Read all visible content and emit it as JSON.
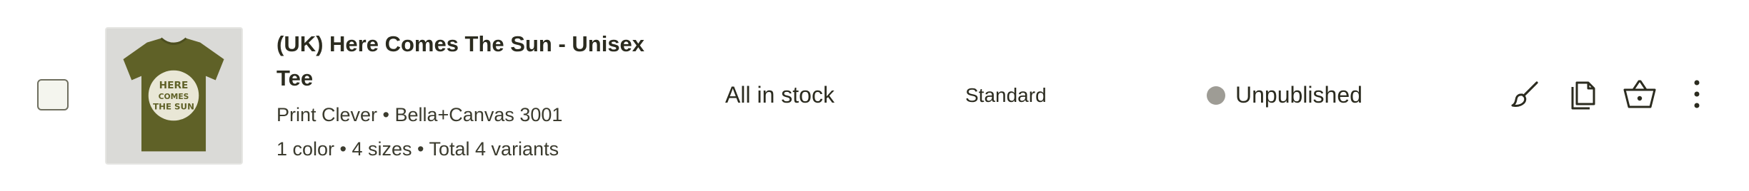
{
  "product": {
    "title": "(UK) Here Comes The Sun - Unisex Tee",
    "provider_line": "Print Clever • Bella+Canvas 3001",
    "variants_line": "1 color • 4 sizes • Total 4 variants",
    "thumbnail_text": "HERE COMES THE SUN",
    "stock": "All in stock",
    "shipping": "Standard",
    "status": "Unpublished"
  },
  "colors": {
    "shirt": "#5f6127",
    "status_dot": "#9e9c95",
    "text": "#2b2b1f"
  },
  "icons": {
    "edit": "brush-icon",
    "duplicate": "copy-icon",
    "order": "basket-icon",
    "more": "more-vertical-icon"
  }
}
